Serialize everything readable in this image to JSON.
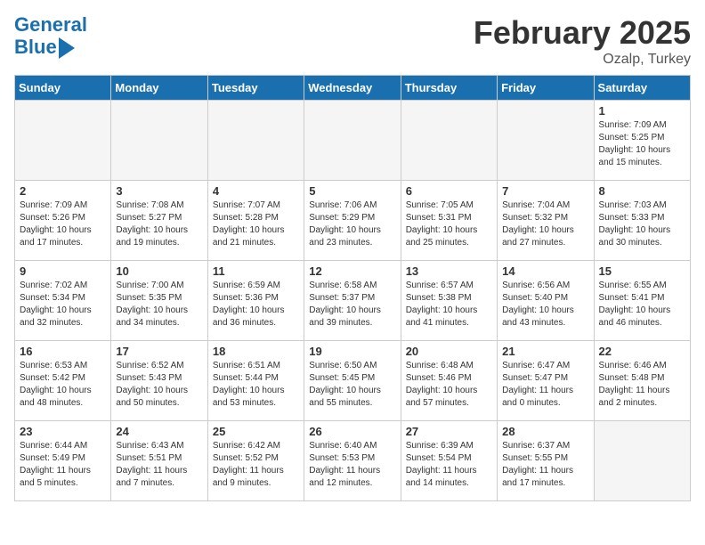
{
  "header": {
    "logo_line1": "General",
    "logo_line2": "Blue",
    "month": "February 2025",
    "location": "Ozalp, Turkey"
  },
  "days_of_week": [
    "Sunday",
    "Monday",
    "Tuesday",
    "Wednesday",
    "Thursday",
    "Friday",
    "Saturday"
  ],
  "weeks": [
    [
      {
        "day": "",
        "info": ""
      },
      {
        "day": "",
        "info": ""
      },
      {
        "day": "",
        "info": ""
      },
      {
        "day": "",
        "info": ""
      },
      {
        "day": "",
        "info": ""
      },
      {
        "day": "",
        "info": ""
      },
      {
        "day": "1",
        "info": "Sunrise: 7:09 AM\nSunset: 5:25 PM\nDaylight: 10 hours\nand 15 minutes."
      }
    ],
    [
      {
        "day": "2",
        "info": "Sunrise: 7:09 AM\nSunset: 5:26 PM\nDaylight: 10 hours\nand 17 minutes."
      },
      {
        "day": "3",
        "info": "Sunrise: 7:08 AM\nSunset: 5:27 PM\nDaylight: 10 hours\nand 19 minutes."
      },
      {
        "day": "4",
        "info": "Sunrise: 7:07 AM\nSunset: 5:28 PM\nDaylight: 10 hours\nand 21 minutes."
      },
      {
        "day": "5",
        "info": "Sunrise: 7:06 AM\nSunset: 5:29 PM\nDaylight: 10 hours\nand 23 minutes."
      },
      {
        "day": "6",
        "info": "Sunrise: 7:05 AM\nSunset: 5:31 PM\nDaylight: 10 hours\nand 25 minutes."
      },
      {
        "day": "7",
        "info": "Sunrise: 7:04 AM\nSunset: 5:32 PM\nDaylight: 10 hours\nand 27 minutes."
      },
      {
        "day": "8",
        "info": "Sunrise: 7:03 AM\nSunset: 5:33 PM\nDaylight: 10 hours\nand 30 minutes."
      }
    ],
    [
      {
        "day": "9",
        "info": "Sunrise: 7:02 AM\nSunset: 5:34 PM\nDaylight: 10 hours\nand 32 minutes."
      },
      {
        "day": "10",
        "info": "Sunrise: 7:00 AM\nSunset: 5:35 PM\nDaylight: 10 hours\nand 34 minutes."
      },
      {
        "day": "11",
        "info": "Sunrise: 6:59 AM\nSunset: 5:36 PM\nDaylight: 10 hours\nand 36 minutes."
      },
      {
        "day": "12",
        "info": "Sunrise: 6:58 AM\nSunset: 5:37 PM\nDaylight: 10 hours\nand 39 minutes."
      },
      {
        "day": "13",
        "info": "Sunrise: 6:57 AM\nSunset: 5:38 PM\nDaylight: 10 hours\nand 41 minutes."
      },
      {
        "day": "14",
        "info": "Sunrise: 6:56 AM\nSunset: 5:40 PM\nDaylight: 10 hours\nand 43 minutes."
      },
      {
        "day": "15",
        "info": "Sunrise: 6:55 AM\nSunset: 5:41 PM\nDaylight: 10 hours\nand 46 minutes."
      }
    ],
    [
      {
        "day": "16",
        "info": "Sunrise: 6:53 AM\nSunset: 5:42 PM\nDaylight: 10 hours\nand 48 minutes."
      },
      {
        "day": "17",
        "info": "Sunrise: 6:52 AM\nSunset: 5:43 PM\nDaylight: 10 hours\nand 50 minutes."
      },
      {
        "day": "18",
        "info": "Sunrise: 6:51 AM\nSunset: 5:44 PM\nDaylight: 10 hours\nand 53 minutes."
      },
      {
        "day": "19",
        "info": "Sunrise: 6:50 AM\nSunset: 5:45 PM\nDaylight: 10 hours\nand 55 minutes."
      },
      {
        "day": "20",
        "info": "Sunrise: 6:48 AM\nSunset: 5:46 PM\nDaylight: 10 hours\nand 57 minutes."
      },
      {
        "day": "21",
        "info": "Sunrise: 6:47 AM\nSunset: 5:47 PM\nDaylight: 11 hours\nand 0 minutes."
      },
      {
        "day": "22",
        "info": "Sunrise: 6:46 AM\nSunset: 5:48 PM\nDaylight: 11 hours\nand 2 minutes."
      }
    ],
    [
      {
        "day": "23",
        "info": "Sunrise: 6:44 AM\nSunset: 5:49 PM\nDaylight: 11 hours\nand 5 minutes."
      },
      {
        "day": "24",
        "info": "Sunrise: 6:43 AM\nSunset: 5:51 PM\nDaylight: 11 hours\nand 7 minutes."
      },
      {
        "day": "25",
        "info": "Sunrise: 6:42 AM\nSunset: 5:52 PM\nDaylight: 11 hours\nand 9 minutes."
      },
      {
        "day": "26",
        "info": "Sunrise: 6:40 AM\nSunset: 5:53 PM\nDaylight: 11 hours\nand 12 minutes."
      },
      {
        "day": "27",
        "info": "Sunrise: 6:39 AM\nSunset: 5:54 PM\nDaylight: 11 hours\nand 14 minutes."
      },
      {
        "day": "28",
        "info": "Sunrise: 6:37 AM\nSunset: 5:55 PM\nDaylight: 11 hours\nand 17 minutes."
      },
      {
        "day": "",
        "info": ""
      }
    ]
  ]
}
